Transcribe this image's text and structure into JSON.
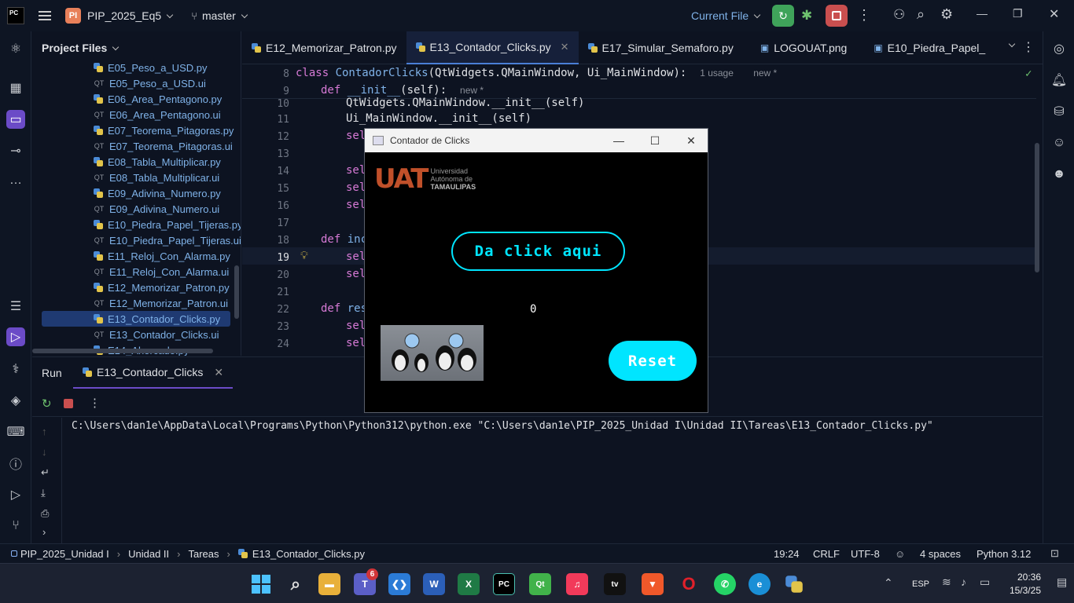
{
  "titlebar": {
    "app_logo": "PC",
    "project_badge": "PI",
    "project_name": "PIP_2025_Eq5",
    "branch": "master",
    "run_config": "Current File"
  },
  "project_panel": {
    "title": "Project Files",
    "items": [
      {
        "name": "E05_Peso_a_USD.py",
        "type": "py"
      },
      {
        "name": "E05_Peso_a_USD.ui",
        "type": "ui"
      },
      {
        "name": "E06_Area_Pentagono.py",
        "type": "py"
      },
      {
        "name": "E06_Area_Pentagono.ui",
        "type": "ui"
      },
      {
        "name": "E07_Teorema_Pitagoras.py",
        "type": "py"
      },
      {
        "name": "E07_Teorema_Pitagoras.ui",
        "type": "ui"
      },
      {
        "name": "E08_Tabla_Multiplicar.py",
        "type": "py"
      },
      {
        "name": "E08_Tabla_Multiplicar.ui",
        "type": "ui"
      },
      {
        "name": "E09_Adivina_Numero.py",
        "type": "py"
      },
      {
        "name": "E09_Adivina_Numero.ui",
        "type": "ui"
      },
      {
        "name": "E10_Piedra_Papel_Tijeras.py",
        "type": "py"
      },
      {
        "name": "E10_Piedra_Papel_Tijeras.ui",
        "type": "ui"
      },
      {
        "name": "E11_Reloj_Con_Alarma.py",
        "type": "py"
      },
      {
        "name": "E11_Reloj_Con_Alarma.ui",
        "type": "ui"
      },
      {
        "name": "E12_Memorizar_Patron.py",
        "type": "py"
      },
      {
        "name": "E12_Memorizar_Patron.ui",
        "type": "ui"
      },
      {
        "name": "E13_Contador_Clicks.py",
        "type": "py"
      },
      {
        "name": "E13_Contador_Clicks.ui",
        "type": "ui"
      },
      {
        "name": "E14_Ahorcado.py",
        "type": "py"
      }
    ]
  },
  "tabs": [
    {
      "label": "E12_Memorizar_Patron.py"
    },
    {
      "label": "E13_Contador_Clicks.py"
    },
    {
      "label": "E17_Simular_Semaforo.py"
    },
    {
      "label": "LOGOUAT.png"
    },
    {
      "label": "E10_Piedra_Papel_"
    }
  ],
  "editor": {
    "line_numbers": [
      "8",
      "9",
      "10",
      "11",
      "12",
      "13",
      "14",
      "15",
      "16",
      "17",
      "18",
      "19",
      "20",
      "21",
      "22",
      "23",
      "24"
    ],
    "line8": {
      "kw": "class ",
      "name": "ContadorClicks",
      "rest": "(QtWidgets.QMainWindow, Ui_MainWindow):",
      "hint1": "1 usage",
      "hint2": "new *"
    },
    "line9": {
      "kw": "def ",
      "name": "__init__",
      "rest": "(self):",
      "hint": "new *"
    },
    "line10": "QtWidgets.QMainWindow.__init__(self)",
    "line11": "Ui_MainWindow.__init__(self)",
    "line12": "sel",
    "line14": "sel",
    "line15": "sel",
    "line16": "sel",
    "line18": {
      "kw": "def ",
      "name": "inc"
    },
    "line19": "sel",
    "line20": "sel",
    "line22": {
      "kw": "def ",
      "name": "res"
    },
    "line23": "sel",
    "line24": "sel"
  },
  "run_panel": {
    "tab_run": "Run",
    "tab_config": "E13_Contador_Clicks",
    "command": "C:\\Users\\dan1e\\AppData\\Local\\Programs\\Python\\Python312\\python.exe \"C:\\Users\\dan1e\\PIP_2025_Unidad I\\Unidad II\\Tareas\\E13_Contador_Clicks.py\""
  },
  "qt_window": {
    "title": "Contador de Clicks",
    "logo_text": "UAT",
    "logo_sub1": "Universidad",
    "logo_sub2": "Autónoma de",
    "logo_sub3": "TAMAULIPAS",
    "click_button": "Da click aqui",
    "counter": "0",
    "reset_button": "Reset"
  },
  "statusbar": {
    "crumbs": [
      "PIP_2025_Unidad I",
      "Unidad II",
      "Tareas",
      "E13_Contador_Clicks.py"
    ],
    "position": "19:24",
    "line_sep": "CRLF",
    "encoding": "UTF-8",
    "indent": "4 spaces",
    "interpreter": "Python 3.12"
  },
  "taskbar": {
    "teams_badge": "6",
    "lang": "ESP",
    "time": "20:36",
    "date": "15/3/25"
  },
  "colors": {
    "accent_cyan": "#00e5ff",
    "run_green": "#3fa35a",
    "stop_red": "#c94f4f",
    "selection_blue": "#1f3a72"
  }
}
